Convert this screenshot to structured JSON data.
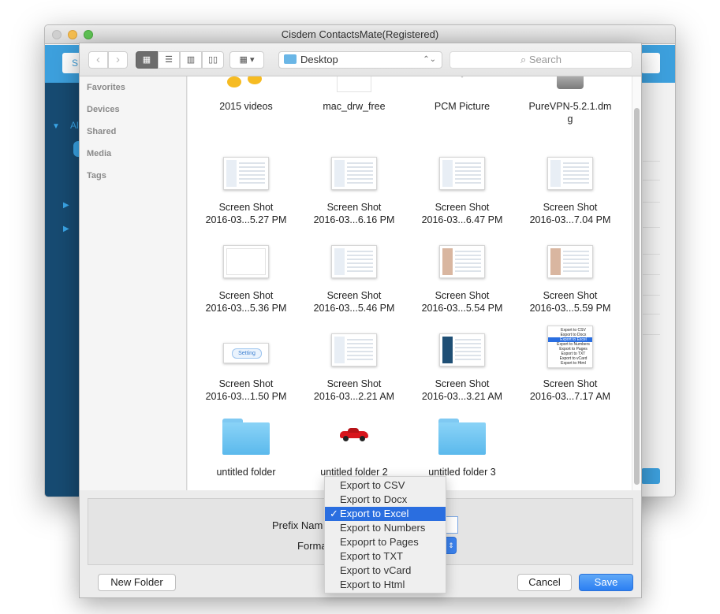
{
  "main_window": {
    "title": "Cisdem ContactsMate(Registered)",
    "accent_color": "#3da0dd",
    "sidebar_color": "#174b72",
    "search_hint": "S",
    "sidebar_label": "Al"
  },
  "toolbar": {
    "back_icon": "chevron-left-icon",
    "forward_icon": "chevron-right-icon",
    "views": [
      "icon-view",
      "list-view",
      "column-view",
      "cover-flow-view"
    ],
    "arrange_icon": "arrange-grid-icon",
    "location": "Desktop",
    "search_placeholder": "Search"
  },
  "sidebar": {
    "sections": [
      "Favorites",
      "Devices",
      "Shared",
      "Media",
      "Tags"
    ]
  },
  "files": [
    {
      "line1": "2015 videos",
      "line2": "",
      "kind": "music"
    },
    {
      "line1": "mac_drw_free",
      "line2": "",
      "kind": "doc"
    },
    {
      "line1": "PCM Picture",
      "line2": "",
      "kind": "pin"
    },
    {
      "line1": "PureVPN-5.2.1.dm",
      "line2": "g",
      "kind": "disk"
    },
    {
      "line1": "Screen Shot",
      "line2": "2016-03...5.27 PM",
      "kind": "shot"
    },
    {
      "line1": "Screen Shot",
      "line2": "2016-03...6.16 PM",
      "kind": "shot"
    },
    {
      "line1": "Screen Shot",
      "line2": "2016-03...6.47 PM",
      "kind": "shot"
    },
    {
      "line1": "Screen Shot",
      "line2": "2016-03...7.04 PM",
      "kind": "shot"
    },
    {
      "line1": "Screen Shot",
      "line2": "2016-03...5.36 PM",
      "kind": "blank"
    },
    {
      "line1": "Screen Shot",
      "line2": "2016-03...5.46 PM",
      "kind": "shot"
    },
    {
      "line1": "Screen Shot",
      "line2": "2016-03...5.54 PM",
      "kind": "shot-color"
    },
    {
      "line1": "Screen Shot",
      "line2": "2016-03...5.59 PM",
      "kind": "shot-color"
    },
    {
      "line1": "Screen Shot",
      "line2": "2016-03...1.50 PM",
      "kind": "setting"
    },
    {
      "line1": "Screen Shot",
      "line2": "2016-03...2.21 AM",
      "kind": "shot"
    },
    {
      "line1": "Screen Shot",
      "line2": "2016-03...3.21 AM",
      "kind": "shot-dark"
    },
    {
      "line1": "Screen Shot",
      "line2": "2016-03...7.17 AM",
      "kind": "menu"
    },
    {
      "line1": "untitled folder",
      "line2": "",
      "kind": "folder"
    },
    {
      "line1": "untitled folder 2",
      "line2": "",
      "kind": "car"
    },
    {
      "line1": "untitled folder 3",
      "line2": "",
      "kind": "folder"
    }
  ],
  "thumb_texts": {
    "setting": "Setting",
    "menu": [
      "Export to CSV",
      "Export to Docx",
      "Export to Excel",
      "Export to Numbers",
      "Export to Pages",
      "Export to TXT",
      "Export to vCard",
      "Export to Html"
    ]
  },
  "form": {
    "prefix_label": "Prefix Nam",
    "format_label": "Forma"
  },
  "buttons": {
    "new_folder": "New Folder",
    "cancel": "Cancel",
    "save": "Save"
  },
  "format_menu": {
    "selected": "Export to Excel",
    "options": [
      "Export to CSV",
      "Export to Docx",
      "Export to Excel",
      "Export to Numbers",
      "Expoprt to Pages",
      "Export to TXT",
      "Export to vCard",
      "Export to Html"
    ],
    "check": "✓"
  }
}
